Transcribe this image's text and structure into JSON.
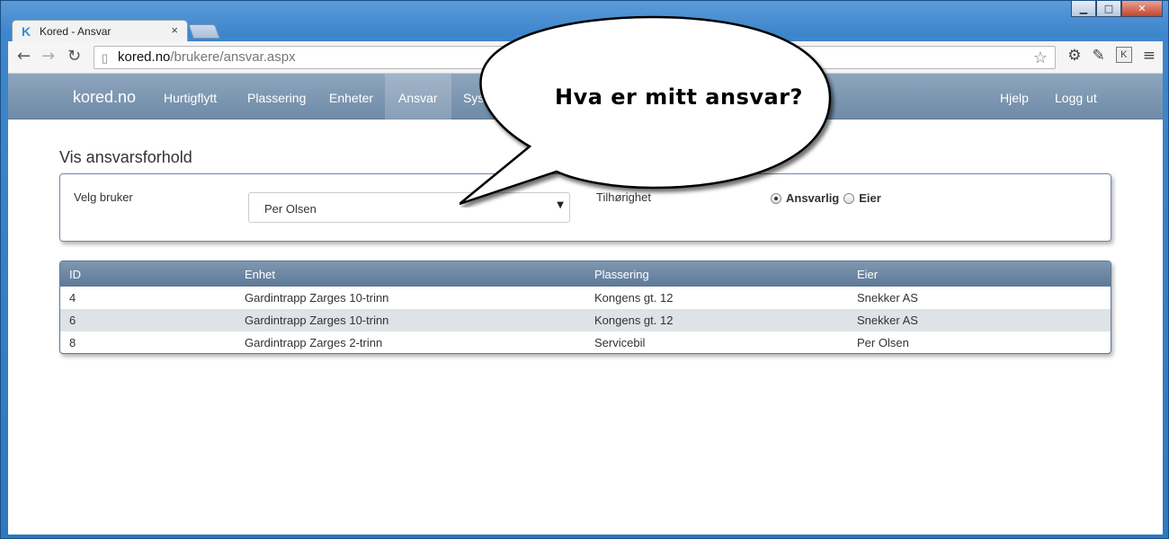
{
  "window": {
    "tab_title": "Kored - Ansvar",
    "tab_favicon": "K",
    "tab_close": "×",
    "controls": {
      "minimize": "▁",
      "maximize": "□",
      "close": "✕"
    }
  },
  "toolbar": {
    "back": "←",
    "forward": "→",
    "reload": "↻",
    "url_host": "kored.no",
    "url_path": "/brukere/ansvar.aspx",
    "star": "☆",
    "settings": "⚙",
    "dropper": "✎",
    "ext": "K",
    "menu": "≡"
  },
  "navbar": {
    "brand": "kored.no",
    "items": [
      "Hurtigflytt",
      "Plassering",
      "Enheter",
      "Ansvar",
      "Sys"
    ],
    "right_items": [
      "Hjelp",
      "Logg ut"
    ],
    "active": "Ansvar"
  },
  "main": {
    "title": "Vis ansvarsforhold",
    "user_label": "Velg bruker",
    "user_value": "Per Olsen",
    "belonging_label": "Tilhørighet",
    "radio_ansvarlig": "Ansvarlig",
    "radio_eier": "Eier",
    "radio_selected": "Ansvarlig"
  },
  "table": {
    "headers": [
      "ID",
      "Enhet",
      "Plassering",
      "Eier"
    ],
    "rows": [
      [
        "4",
        "Gardintrapp Zarges 10-trinn",
        "Kongens gt. 12",
        "Snekker AS"
      ],
      [
        "6",
        "Gardintrapp Zarges 10-trinn",
        "Kongens gt. 12",
        "Snekker AS"
      ],
      [
        "8",
        "Gardintrapp Zarges 2-trinn",
        "Servicebil",
        "Per Olsen"
      ]
    ]
  },
  "callout": {
    "text": "Hva er mitt ansvar?"
  },
  "colors": {
    "navbar": "#7d95b0",
    "table_header": "#6a849f",
    "frame": "#2f78c0"
  }
}
